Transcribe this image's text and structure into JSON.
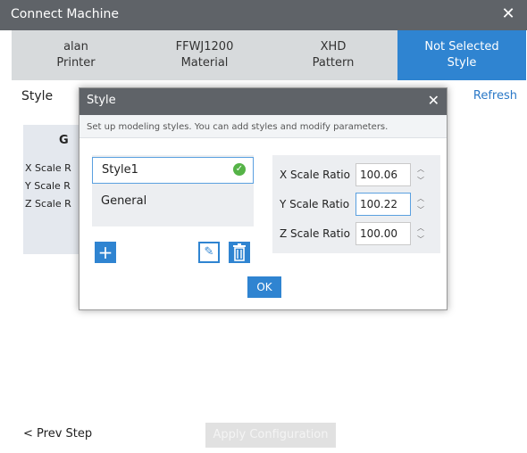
{
  "window": {
    "title": "Connect Machine",
    "close_symbol": "✕"
  },
  "tabs": [
    {
      "line1": "alan",
      "line2": "Printer"
    },
    {
      "line1": "FFWJ1200",
      "line2": "Material"
    },
    {
      "line1": "XHD",
      "line2": "Pattern"
    },
    {
      "line1": "Not Selected",
      "line2": "Style"
    }
  ],
  "main": {
    "section_label": "Style",
    "refresh_label": "Refresh",
    "card_letter": "G",
    "card_rows": [
      "X Scale R",
      "Y Scale R",
      "Z Scale R"
    ]
  },
  "footer": {
    "prev_label": "< Prev Step",
    "apply_label": "Apply Configuration"
  },
  "dialog": {
    "title": "Style",
    "close_symbol": "✕",
    "description": "Set up modeling styles. You can add styles and modify parameters.",
    "styles": [
      {
        "name": "Style1",
        "selected": true
      },
      {
        "name": "General",
        "selected": false
      }
    ],
    "params": [
      {
        "label": "X Scale Ratio",
        "value": "100.06"
      },
      {
        "label": "Y Scale Ratio",
        "value": "100.22"
      },
      {
        "label": "Z Scale Ratio",
        "value": "100.00"
      }
    ],
    "ok_label": "OK"
  },
  "colors": {
    "accent": "#2f84d1",
    "titlebar": "#5f6368",
    "tab_inactive": "#d7dadc",
    "check": "#55b347"
  },
  "icons": [
    "close-icon",
    "check-icon",
    "add-icon",
    "edit-icon",
    "delete-icon",
    "spin-up-icon",
    "spin-down-icon"
  ]
}
